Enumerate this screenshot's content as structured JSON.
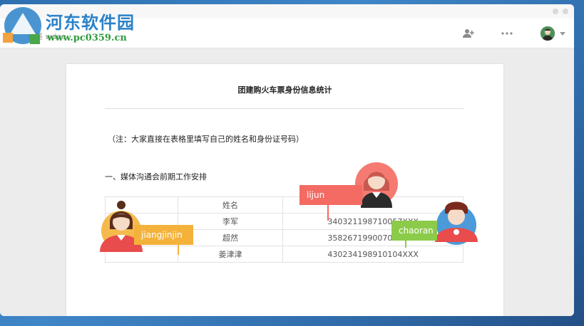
{
  "toolbar": {
    "doc_name": "石墨 wdoc",
    "add_collaborator_icon": "person-add-icon",
    "more_icon": "more-horizontal-icon",
    "avatar_icon": "user-avatar-icon",
    "caret_icon": "chevron-down-icon"
  },
  "document": {
    "title": "团建购火车票身份信息统计",
    "note": "（注：大家直接在表格里填写自己的姓名和身份证号码）",
    "section_heading": "一、媒体沟通会前期工作安排",
    "table": {
      "rows": [
        [
          "",
          "姓名",
          ""
        ],
        [
          "",
          "李军",
          "340321198710057XXX"
        ],
        [
          "",
          "超然",
          "358267199007017XXX"
        ],
        [
          "",
          "姜津津",
          "430234198910104XXX"
        ]
      ]
    }
  },
  "collaborators": [
    {
      "name": "lijun",
      "color": "#f36b63"
    },
    {
      "name": "jiangjinjin",
      "color": "#f4b23a"
    },
    {
      "name": "chaoran",
      "color": "#8ccb4a"
    }
  ],
  "watermark": {
    "site_name": "河东软件园",
    "url": "www.pc0359.cn"
  },
  "colors": {
    "background": "#3f86c7",
    "canvas": "#ececec",
    "brand_blue": "#2a82c9",
    "brand_green": "#2f9b3c"
  }
}
